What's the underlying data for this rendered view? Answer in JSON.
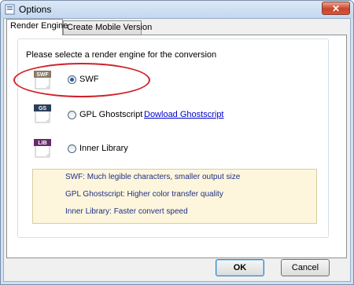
{
  "window": {
    "title": "Options",
    "close_glyph": "✕"
  },
  "tabs": [
    {
      "label": "Render Engine",
      "active": true
    },
    {
      "label": "Create Mobile Version",
      "active": false
    }
  ],
  "group": {
    "label": "Please selecte a render engine for the conversion"
  },
  "engines": [
    {
      "badge": "SWF",
      "label": "SWF",
      "selected": true,
      "badge_color": "#8a7a66"
    },
    {
      "badge": "GS",
      "label": "GPL Ghostscript",
      "selected": false,
      "badge_color": "#2a3f5c"
    },
    {
      "badge": "LIB",
      "label": "Inner Library",
      "selected": false,
      "badge_color": "#6a2a6a"
    }
  ],
  "download_link": "Dowload Ghostscript",
  "info": [
    "SWF: Much legible characters, smaller output size",
    "GPL Ghostscript: Higher color transfer quality",
    "Inner Library: Faster convert speed"
  ],
  "buttons": {
    "ok": "OK",
    "cancel": "Cancel"
  },
  "colors": {
    "annotation": "#d0212a",
    "info_text": "#1f2f86",
    "link": "#0000cc"
  }
}
